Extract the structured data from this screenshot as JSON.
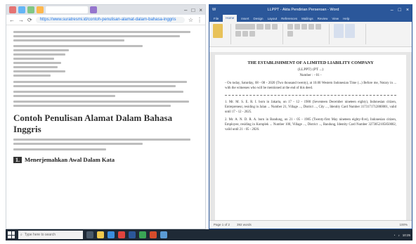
{
  "browser": {
    "url": "https://www.suratresmi.id/contoh-penulisan-alamat-dalam-bahasa-inggris",
    "paragraph_lines": 3,
    "heading": "Contoh Penulisan Alamat Dalam Bahasa Inggris",
    "subheading_number": "1.",
    "subheading": "Menerjemahkan Awal Dalam Kata"
  },
  "word": {
    "title_bar": "LLPPT - Akta Pendirian Perseroan - Word",
    "tabs": [
      "File",
      "Home",
      "Insert",
      "Design",
      "Layout",
      "References",
      "Mailings",
      "Review",
      "View",
      "Help"
    ],
    "active_tab": "Home",
    "doc_title": "THE ESTABLISHMENT OF A LIMITED LIABILITY COMPANY",
    "doc_sub": "(LLPPT) (PT ...)",
    "doc_number": "Number : - 01 -",
    "doc_p1": "- On today, Saturday, 08 - 08 - 2020 (Two thousand twenty), at 10.00 Western Indonesian Time (...) Before me, Notary in ... with the witnesses who will be mentioned at the end of this deed.",
    "doc_p2": "1. Mr. M. S. E. R. I. born in Jakarta, on 17 - 12 - 1980 (Seventeen December nineteen eighty), Indonesian citizen, Entrepreneur, residing in Jalan ... Number 21, Village ..., District ..., City ..., Identity Card Number 3173171712800001, valid until 17 - 12 - 2025.",
    "doc_p3": "2. Mr. A. N. D. R. A. born in Bandung, on 21 - 05 - 1985 (Twenty-first May nineteen eighty-five), Indonesian citizen, Employee, residing in Komplek ... Number 100, Village ..., District ..., Bandung, Identity Card Number 3273052105850002, valid until 21 - 05 - 2026.",
    "status_page": "Page 1 of 2",
    "status_words": "392 words",
    "zoom": "100%"
  },
  "taskbar": {
    "search_placeholder": "Type here to search",
    "time": "10:25"
  },
  "colors": {
    "word_blue": "#2b579a",
    "taskbar": "#1f2a36"
  }
}
